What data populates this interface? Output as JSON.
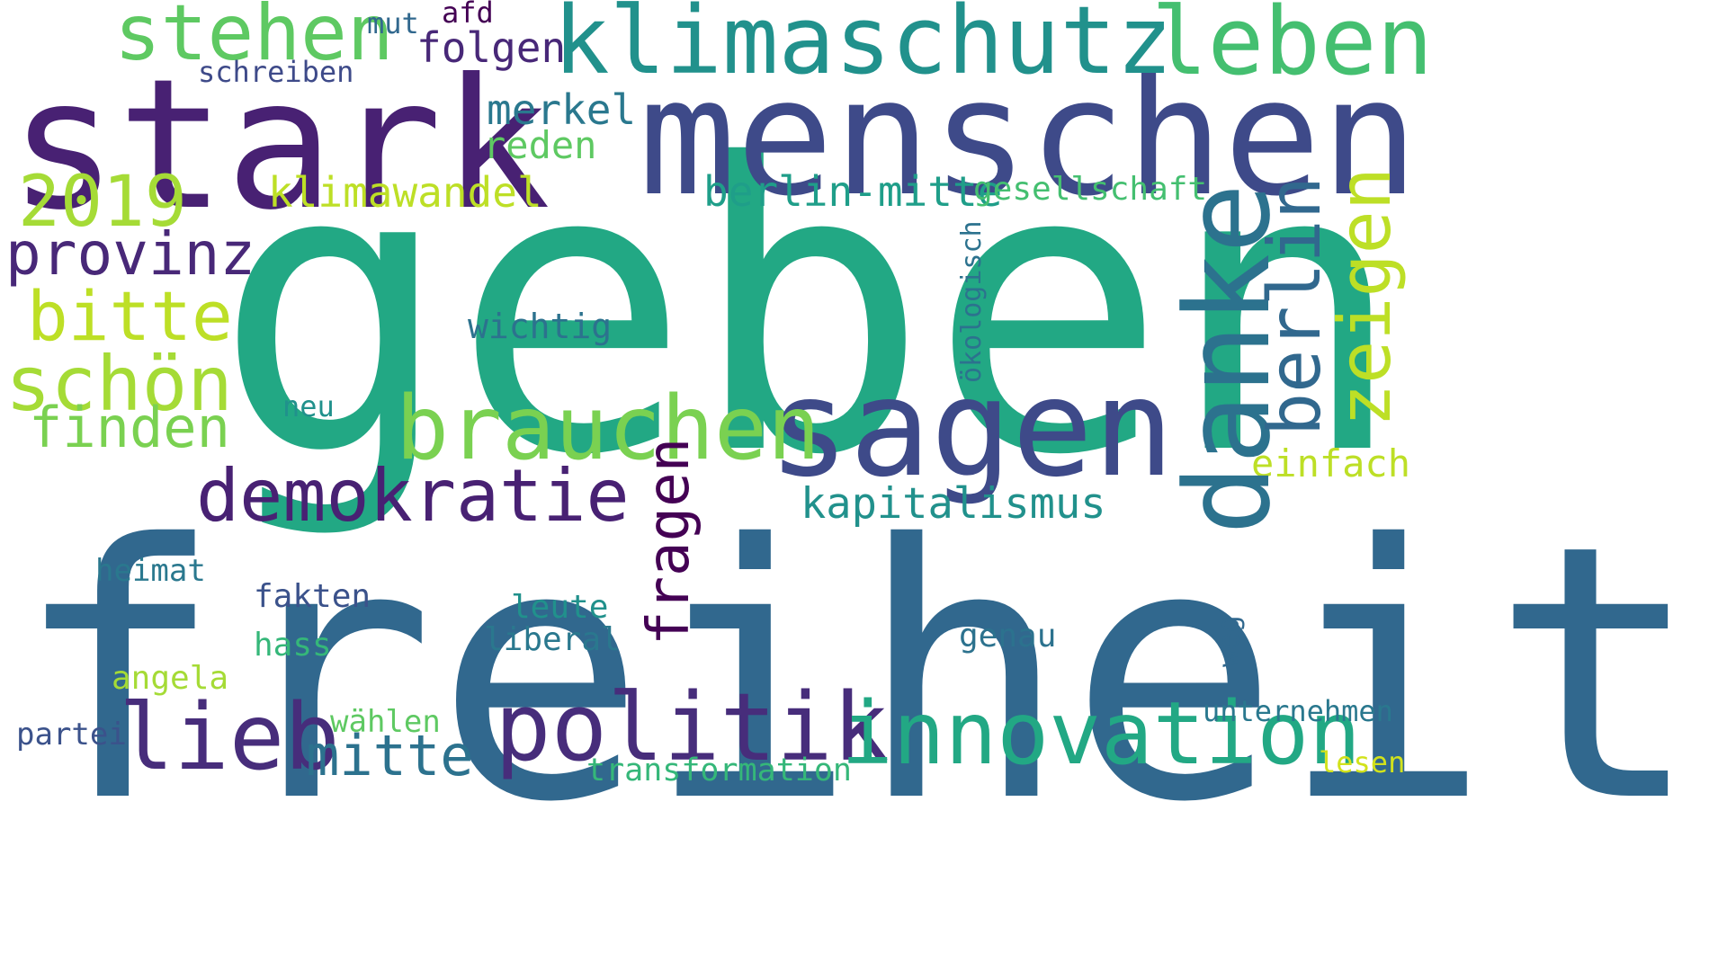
{
  "words": [
    {
      "text": "geben",
      "color": "#22a884"
    },
    {
      "text": "freiheit",
      "color": "#31688e"
    },
    {
      "text": "menschen",
      "color": "#3e4a89"
    },
    {
      "text": "stark",
      "color": "#482173"
    },
    {
      "text": "klimaschutz",
      "color": "#21918c"
    },
    {
      "text": "leben",
      "color": "#44bf70"
    },
    {
      "text": "stehen",
      "color": "#5ec962"
    },
    {
      "text": "sagen",
      "color": "#3e4a89"
    },
    {
      "text": "danke",
      "color": "#2c728e"
    },
    {
      "text": "brauchen",
      "color": "#7ad151"
    },
    {
      "text": "politik",
      "color": "#472d7b"
    },
    {
      "text": "innovation",
      "color": "#22a884"
    },
    {
      "text": "lieb",
      "color": "#472d7b"
    },
    {
      "text": "demokratie",
      "color": "#482173"
    },
    {
      "text": "berlin",
      "color": "#31688e"
    },
    {
      "text": "zeigen",
      "color": "#bddf26"
    },
    {
      "text": "schön",
      "color": "#a5db36"
    },
    {
      "text": "bitte",
      "color": "#bddf26"
    },
    {
      "text": "2019",
      "color": "#a5db36"
    },
    {
      "text": "provinz",
      "color": "#482878"
    },
    {
      "text": "finden",
      "color": "#7ad151"
    },
    {
      "text": "mitte",
      "color": "#2c728e"
    },
    {
      "text": "fragen",
      "color": "#440154"
    },
    {
      "text": "kapitalismus",
      "color": "#21918c"
    },
    {
      "text": "klimawandel",
      "color": "#bddf26"
    },
    {
      "text": "berlin-mitte",
      "color": "#1f9e89"
    },
    {
      "text": "folgen",
      "color": "#482878"
    },
    {
      "text": "merkel",
      "color": "#2a788e"
    },
    {
      "text": "reden",
      "color": "#5ec962"
    },
    {
      "text": "gesellschaft",
      "color": "#44bf70"
    },
    {
      "text": "einfach",
      "color": "#bddf26"
    },
    {
      "text": "ökologisch",
      "color": "#2c728e"
    },
    {
      "text": "wichtig",
      "color": "#2c728e"
    },
    {
      "text": "mut",
      "color": "#31688e"
    },
    {
      "text": "afd",
      "color": "#440154"
    },
    {
      "text": "schreiben",
      "color": "#3e4a89"
    },
    {
      "text": "neu",
      "color": "#21918c"
    },
    {
      "text": "heimat",
      "color": "#2a788e"
    },
    {
      "text": "fakten",
      "color": "#3b528b"
    },
    {
      "text": "leute",
      "color": "#21918c"
    },
    {
      "text": "liberal",
      "color": "#2a788e"
    },
    {
      "text": "hass",
      "color": "#35b779"
    },
    {
      "text": "genau",
      "color": "#2c728e"
    },
    {
      "text": "weg",
      "color": "#31688e"
    },
    {
      "text": "angela",
      "color": "#a5db36"
    },
    {
      "text": "wählen",
      "color": "#5ec962"
    },
    {
      "text": "partei",
      "color": "#3b528b"
    },
    {
      "text": "unternehmen",
      "color": "#2a788e"
    },
    {
      "text": "transformation",
      "color": "#35b779"
    },
    {
      "text": "lesen",
      "color": "#d2e21b"
    }
  ]
}
